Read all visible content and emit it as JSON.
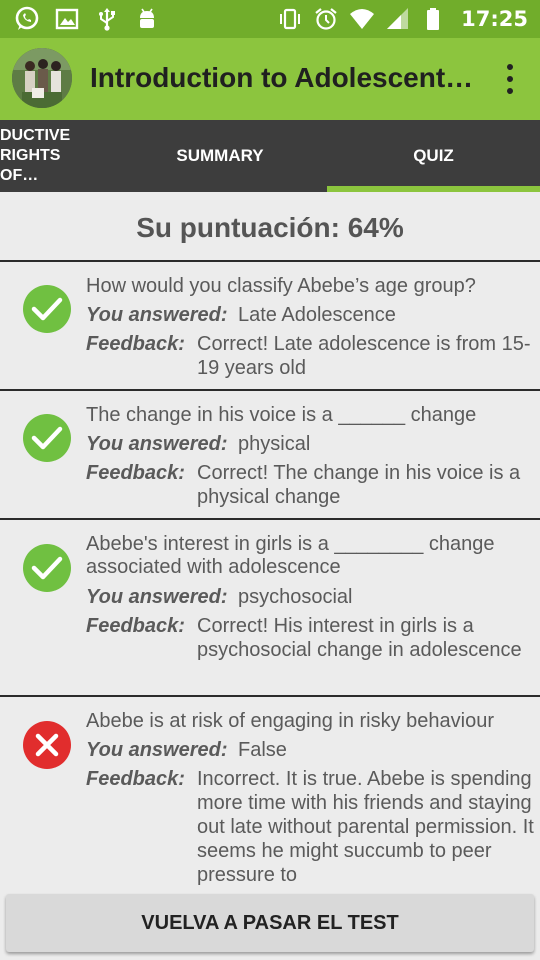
{
  "status_bar": {
    "time": "17:25",
    "icons_left": [
      "whatsapp-icon",
      "image-icon",
      "usb-icon",
      "android-icon"
    ],
    "icons_right": [
      "vibrate-icon",
      "alarm-icon",
      "wifi-icon",
      "signal-icon",
      "battery-icon"
    ],
    "color": "#71ad2b"
  },
  "app_bar": {
    "title": "Introduction to Adolescent…",
    "color": "#8cc53e"
  },
  "tabs": [
    {
      "label": "REPRODUCTIVE RIGHTS OF…",
      "visible_label": "DUCTIVE RIGHTS OF…"
    },
    {
      "label": "SUMMARY"
    },
    {
      "label": "QUIZ",
      "selected": true
    }
  ],
  "score": "Su puntuación: 64%",
  "labels": {
    "answered": "You answered:",
    "feedback": "Feedback:"
  },
  "questions": [
    {
      "status": "correct",
      "question": "How would you classify Abebe’s age group?",
      "answer": "Late Adolescence",
      "feedback": "Correct! Late adolescence is from 15-19 years old"
    },
    {
      "status": "correct",
      "question": "The change in his voice is a ______ change",
      "answer": "physical",
      "feedback": "Correct! The change in his voice is a physical change"
    },
    {
      "status": "correct",
      "question": "Abebe's interest in girls is a ________ change associated with adolescence",
      "answer": "psychosocial",
      "feedback": "Correct! His interest in girls is a psychosocial change in adolescence"
    },
    {
      "status": "incorrect",
      "question": "Abebe is at risk of engaging in risky behaviour",
      "answer": "False",
      "feedback": "Incorrect. It is true. Abebe is spending more time with his friends and staying out late without parental permission. It seems he might succumb to peer pressure to"
    }
  ],
  "retake_button": "VUELVA A PASAR EL TEST",
  "colors": {
    "correct": "#70c041",
    "incorrect": "#e12d2d",
    "tab_bar": "#3d3d3d",
    "tab_indicator": "#8cc53e"
  }
}
